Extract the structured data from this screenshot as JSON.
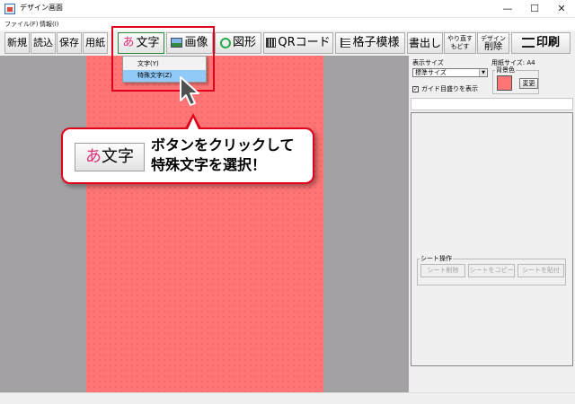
{
  "window": {
    "title": "デザイン画面",
    "minimize": "—",
    "maximize": "☐",
    "close": "✕"
  },
  "menu": [
    "ファイル(F)",
    "情報(I)"
  ],
  "toolbar": {
    "new": "新規",
    "open": "読込",
    "save": "保存",
    "paper": "用紙",
    "text": "文字",
    "text_icon": "あ",
    "image": "画像",
    "shape": "図形",
    "qr": "QRコード",
    "grid": "格子模様",
    "export": "書出し",
    "redo_top": "やり直す",
    "redo_bottom": "もどす",
    "delete_top": "デザイン",
    "delete_bottom": "削除",
    "print": "印刷"
  },
  "dropdown": {
    "items": [
      "文字(Y)",
      "特殊文字(Z)"
    ],
    "selected_index": 1
  },
  "panel": {
    "display_size_label": "表示サイズ",
    "display_size_value": "標準サイズ",
    "paper_size": "用紙サイズ: A4",
    "bg_color_label": "背景色",
    "bg_color": "#ff7575",
    "change_button": "変更",
    "guide_label": "ガイド目盛りを表示",
    "guide_checked": true,
    "sheet_ops_label": "シート操作",
    "sheet_buttons": [
      "シート削除",
      "シートをコピー",
      "シートを貼付"
    ]
  },
  "callout": {
    "button_icon": "あ",
    "button_label": "文字",
    "line1": "ボタンをクリックして",
    "line2": "特殊文字を選択！"
  },
  "colors": {
    "accent": "#e2001a",
    "canvas": "#ff7575",
    "workspace": "#a3a1a4",
    "selection": "#91c9f7"
  },
  "icons": [
    "app-icon",
    "image-icon",
    "shape-icon",
    "qr-icon",
    "grid-icon",
    "print-icon",
    "mouse-pointer-icon"
  ]
}
